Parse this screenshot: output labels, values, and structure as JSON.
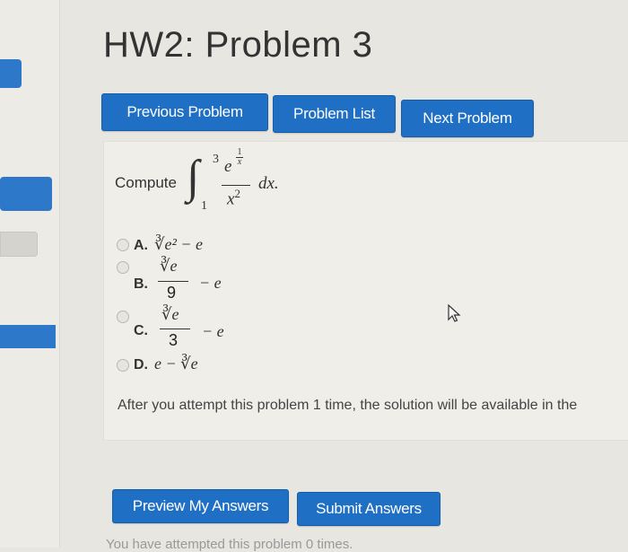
{
  "page": {
    "title": "HW2: Problem 3",
    "nav": {
      "previous_label": "Previous Problem",
      "list_label": "Problem List",
      "next_label": "Next Problem"
    },
    "problem": {
      "prompt": "Compute",
      "integral_symbol": "∫",
      "upper_limit": "3",
      "lower_limit": "1",
      "integrand_base": "e",
      "exp_num": "1",
      "exp_den": "x",
      "denominator": "x2",
      "differential": "dx."
    },
    "options": [
      {
        "label": "A.",
        "expr": "∛e² − e"
      },
      {
        "label": "B.",
        "numerator": "∛e",
        "denominator": "9",
        "tail": "− e"
      },
      {
        "label": "C.",
        "numerator": "∛e",
        "denominator": "3",
        "tail": "− e"
      },
      {
        "label": "D.",
        "expr": "e − ∛e"
      }
    ],
    "info_text": "After you attempt this problem 1 time, the solution will be available in the",
    "actions": {
      "preview_label": "Preview My Answers",
      "submit_label": "Submit Answers"
    },
    "footer_text": "You have attempted this problem 0 times."
  },
  "colors": {
    "button_blue": "#1f6fc5",
    "background": "#e7e6e1"
  }
}
